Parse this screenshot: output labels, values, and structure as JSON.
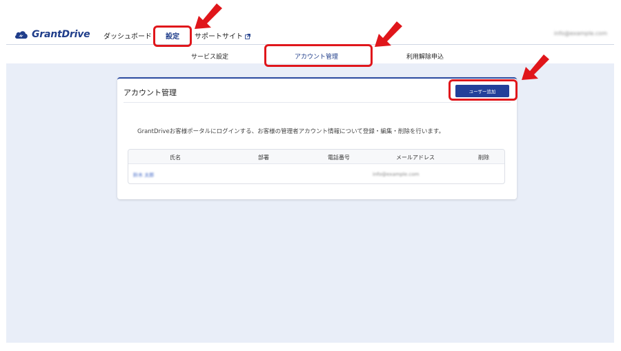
{
  "header": {
    "logo_text": "GrantDrive",
    "nav": {
      "dashboard": "ダッシュボード",
      "settings": "設定",
      "support": "サポートサイト"
    },
    "user_email": "info@example.com"
  },
  "subnav": {
    "service_settings": "サービス設定",
    "account_management": "アカウント管理",
    "cancellation": "利用解除申込"
  },
  "card": {
    "title": "アカウント管理",
    "add_button": "ユーザー追加",
    "description": "GrantDriveお客様ポータルにログインする、お客様の管理者アカウント情報について登録・編集・削除を行います。"
  },
  "table": {
    "columns": [
      "氏名",
      "部署",
      "電話番号",
      "メールアドレス",
      "削除"
    ],
    "rows": [
      {
        "name": "鈴木 太郎",
        "department": "",
        "phone": "",
        "email": "info@example.com",
        "delete": ""
      }
    ]
  },
  "colors": {
    "brand": "#1f3d8a",
    "button": "#23409a",
    "content_bg": "#e9eef8",
    "highlight": "#e0161b"
  },
  "icons": [
    "cloud-logo-icon",
    "external-link-icon",
    "annotation-arrow-icon"
  ]
}
